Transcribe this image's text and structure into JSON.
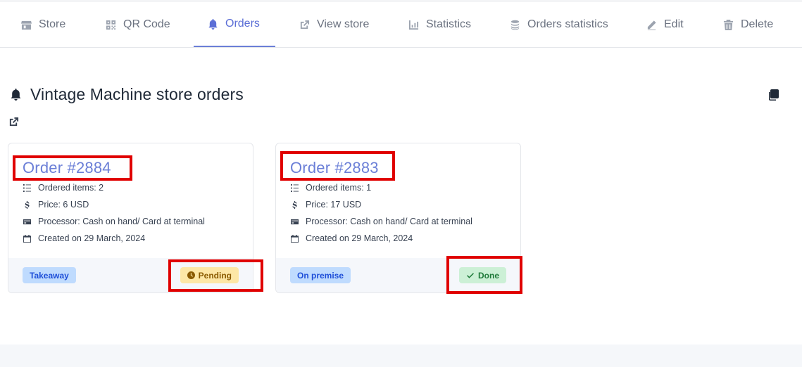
{
  "tabs": [
    {
      "label": "Store",
      "icon": "store-icon"
    },
    {
      "label": "QR Code",
      "icon": "qr-code-icon"
    },
    {
      "label": "Orders",
      "icon": "bell-icon",
      "active": true
    },
    {
      "label": "View store",
      "icon": "external-link-icon"
    },
    {
      "label": "Statistics",
      "icon": "chart-icon"
    },
    {
      "label": "Orders statistics",
      "icon": "coins-icon"
    },
    {
      "label": "Edit",
      "icon": "pencil-icon"
    },
    {
      "label": "Delete",
      "icon": "trash-icon"
    }
  ],
  "page": {
    "title": "Vintage Machine store orders",
    "title_icon": "bell-icon",
    "copy_icon": "copy-icon",
    "link_icon": "external-link-icon"
  },
  "orders": [
    {
      "title": "Order #2884",
      "items": "Ordered items: 2",
      "price": "Price: 6 USD",
      "processor": "Processor: Cash on hand/ Card at terminal",
      "created": "Created on 29 March, 2024",
      "type": "Takeaway",
      "status": "Pending"
    },
    {
      "title": "Order #2883",
      "items": "Ordered items: 1",
      "price": "Price: 17 USD",
      "processor": "Processor: Cash on hand/ Card at terminal",
      "created": "Created on 29 March, 2024",
      "type": "On premise",
      "status": "Done"
    }
  ],
  "colors": {
    "accent": "#6b7fd7",
    "highlight": "#e00000",
    "pending_bg": "#fde7a6",
    "done_bg": "#ccf0d6",
    "type_bg": "#bfdbfe"
  }
}
